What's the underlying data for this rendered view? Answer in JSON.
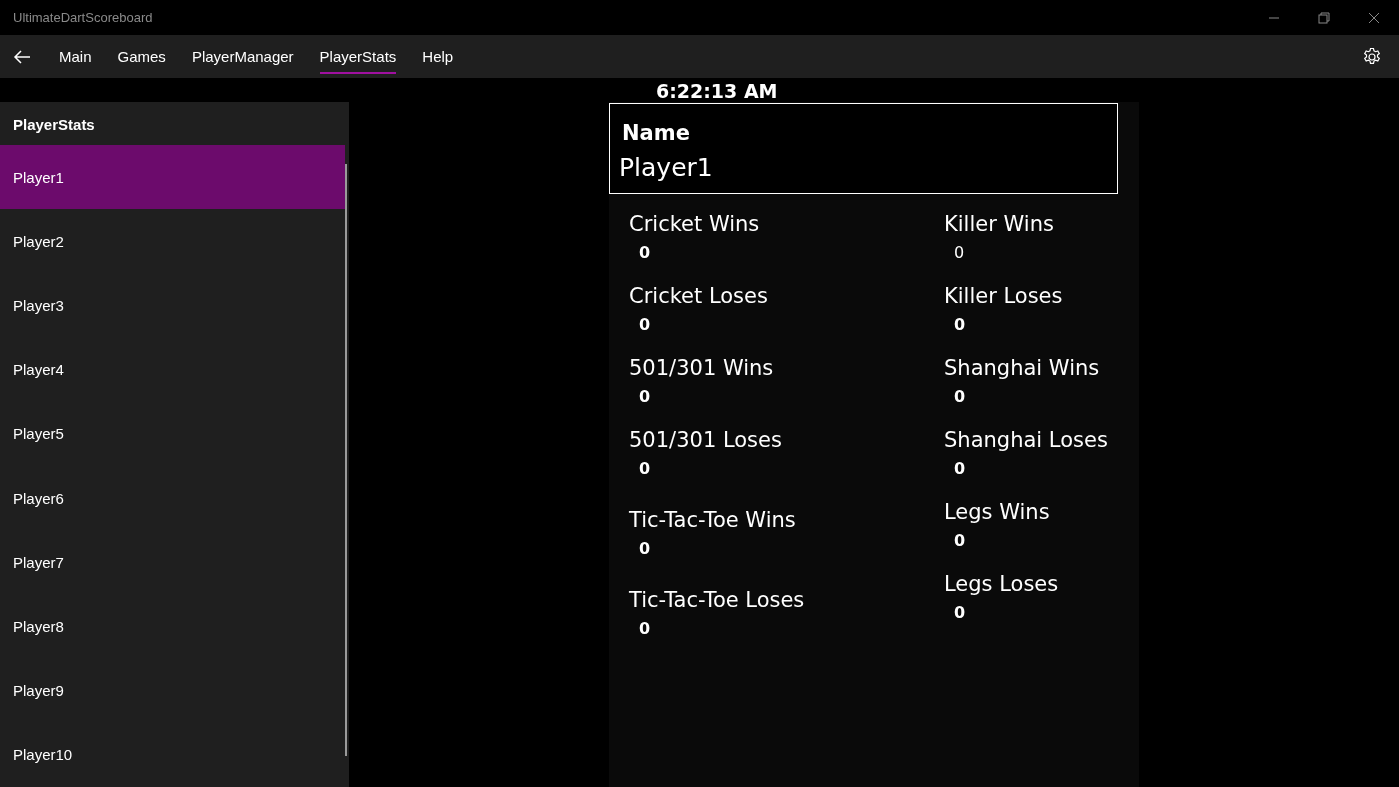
{
  "window": {
    "title": "UltimateDartScoreboard"
  },
  "nav": {
    "tabs": [
      {
        "label": "Main",
        "selected": false
      },
      {
        "label": "Games",
        "selected": false
      },
      {
        "label": "PlayerManager",
        "selected": false
      },
      {
        "label": "PlayerStats",
        "selected": true
      },
      {
        "label": "Help",
        "selected": false
      }
    ]
  },
  "sidebar": {
    "title": "PlayerStats",
    "items": [
      {
        "label": "Player1",
        "selected": true
      },
      {
        "label": "Player2",
        "selected": false
      },
      {
        "label": "Player3",
        "selected": false
      },
      {
        "label": "Player4",
        "selected": false
      },
      {
        "label": "Player5",
        "selected": false
      },
      {
        "label": "Player6",
        "selected": false
      },
      {
        "label": "Player7",
        "selected": false
      },
      {
        "label": "Player8",
        "selected": false
      },
      {
        "label": "Player9",
        "selected": false
      },
      {
        "label": "Player10",
        "selected": false
      }
    ]
  },
  "clock": "6:22:13 AM",
  "name_box": {
    "label": "Name",
    "value": "Player1"
  },
  "stats_left": [
    {
      "label": "Cricket Wins",
      "value": "0",
      "bold": true
    },
    {
      "label": "Cricket Loses",
      "value": "0",
      "bold": true
    },
    {
      "label": "501/301 Wins",
      "value": "0",
      "bold": true
    },
    {
      "label": "501/301 Loses",
      "value": "0",
      "bold": true
    },
    {
      "label": "Tic-Tac-Toe Wins",
      "value": "0",
      "bold": true
    },
    {
      "label": "Tic-Tac-Toe Loses",
      "value": "0",
      "bold": true
    }
  ],
  "stats_right": [
    {
      "label": "Killer Wins",
      "value": "0",
      "bold": false
    },
    {
      "label": "Killer Loses",
      "value": "0",
      "bold": true
    },
    {
      "label": "Shanghai Wins",
      "value": "0",
      "bold": true
    },
    {
      "label": "Shanghai Loses",
      "value": "0",
      "bold": true
    },
    {
      "label": "Legs Wins",
      "value": "0",
      "bold": true
    },
    {
      "label": "Legs Loses",
      "value": "0",
      "bold": true
    }
  ]
}
